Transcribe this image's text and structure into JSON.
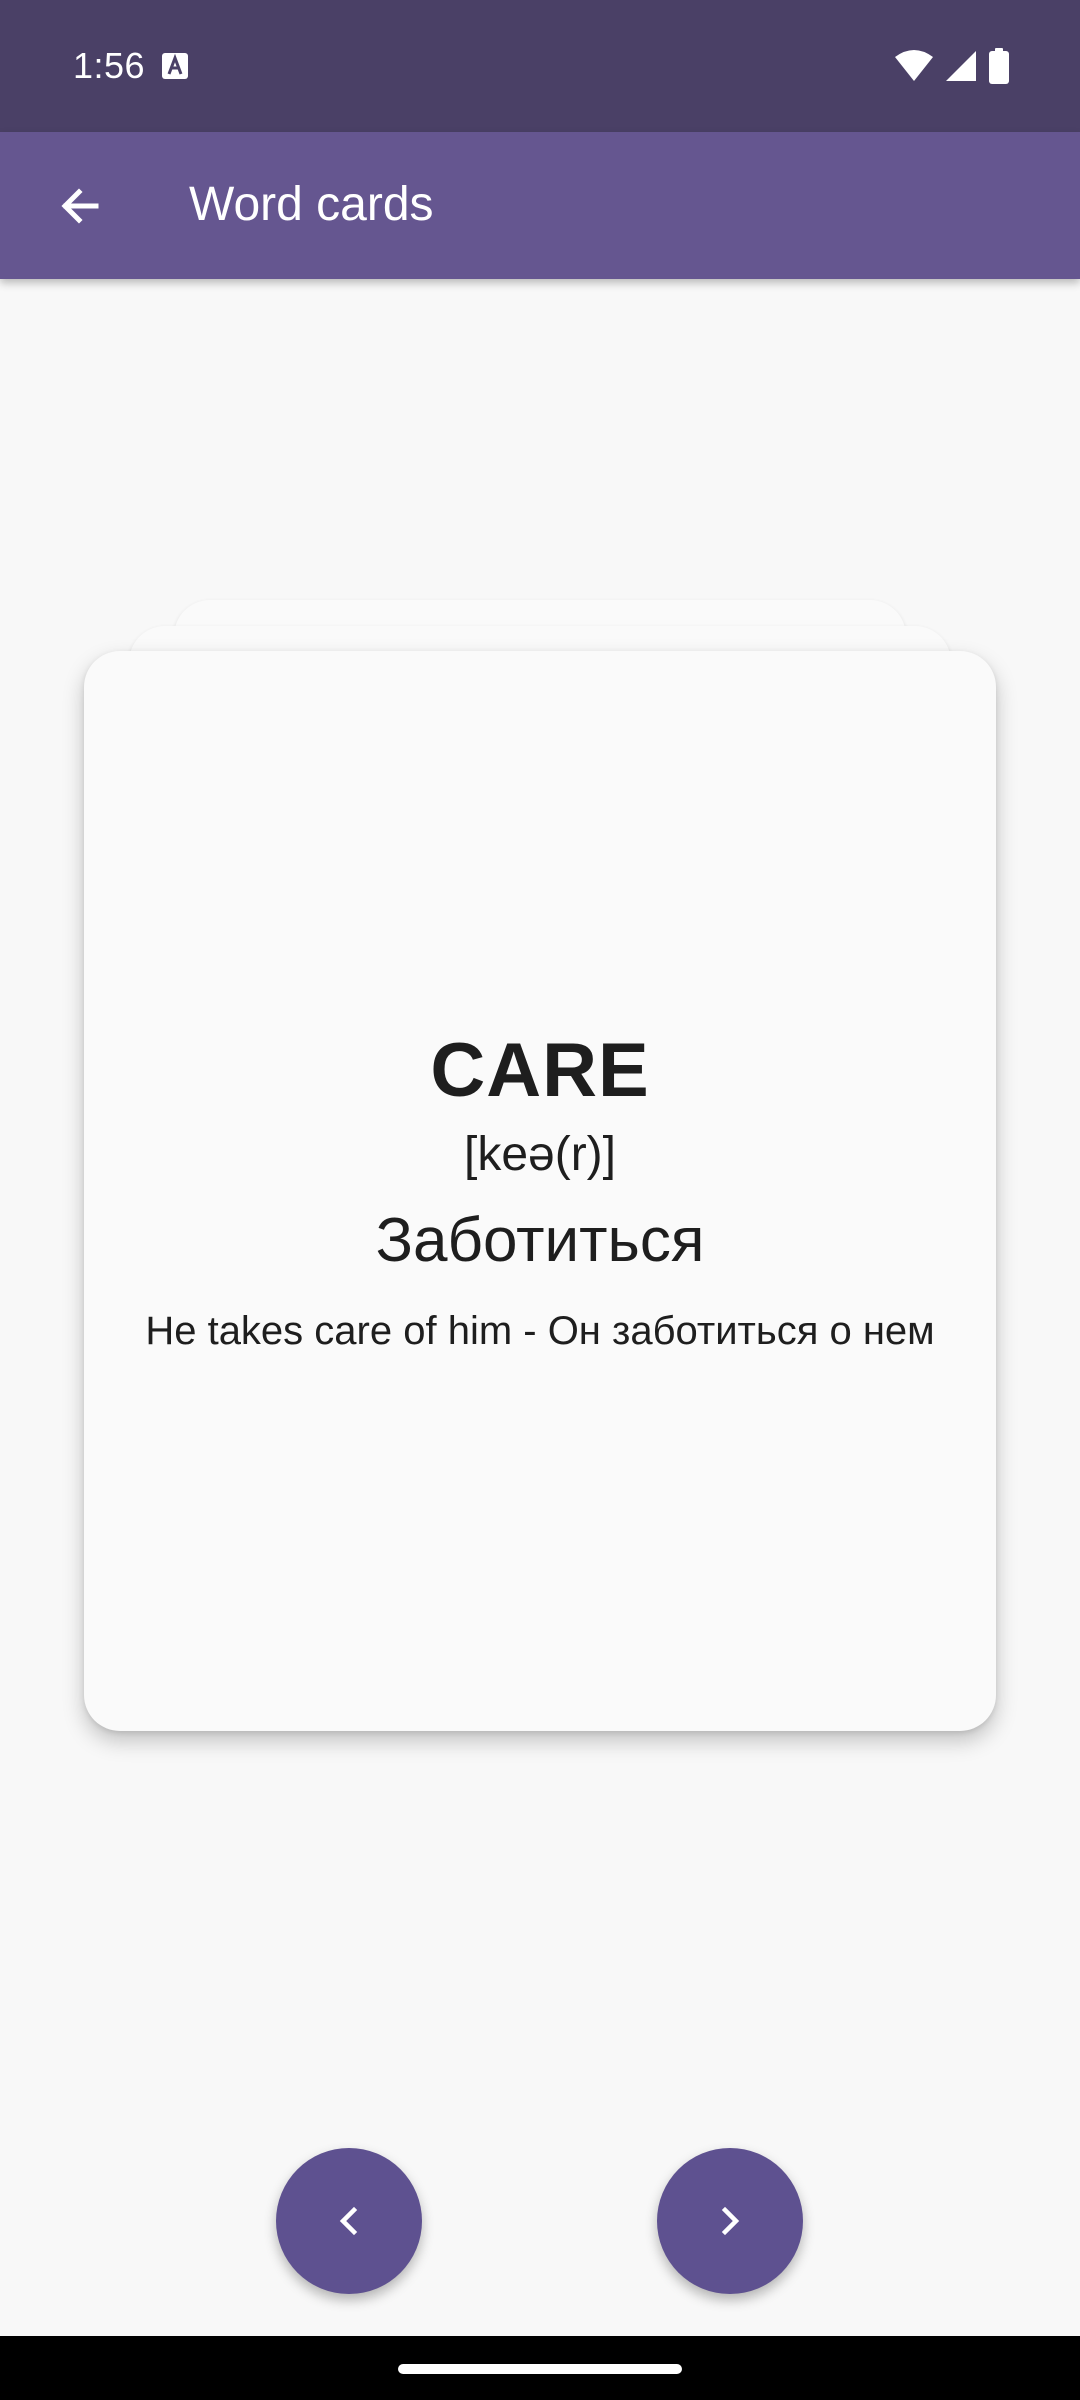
{
  "status_bar": {
    "time": "1:56",
    "icons": [
      "text-notification-icon",
      "wifi-icon",
      "cellular-signal-icon",
      "battery-icon"
    ]
  },
  "app_bar": {
    "title": "Word cards",
    "back_icon": "arrow-back-icon"
  },
  "card": {
    "word": "CARE",
    "transcription": "[keə(r)]",
    "translation": "Заботиться",
    "example": "He takes care of him - Он заботиться о нем"
  },
  "navigation": {
    "prev_icon": "chevron-left-icon",
    "next_icon": "chevron-right-icon"
  },
  "colors": {
    "status_bar": "#4a4066",
    "app_bar": "#655690",
    "accent": "#5e5190",
    "background": "#f8f8f8",
    "card": "#fafafa",
    "text": "#1e1e1e"
  }
}
